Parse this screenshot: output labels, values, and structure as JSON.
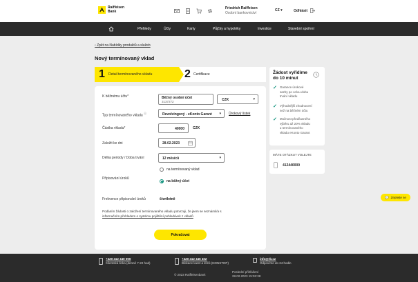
{
  "brand": {
    "name_line1": "Raiffeisen",
    "name_line2": "Bank"
  },
  "header": {
    "user_name": "Friedrich Raiffeisen",
    "user_role": "Osobní bankovnictví",
    "language": "CZ",
    "logout_label": "Odhlásit"
  },
  "nav": {
    "items": [
      "Přehledy",
      "Účty",
      "Karty",
      "Půjčky a hypotéky",
      "Investice",
      "Stavební spoření"
    ]
  },
  "back_link": "Zpět na Nabídky produktů a služeb",
  "page_title": "Nový termínovaný vklad",
  "stepper": {
    "step1_num": "1",
    "step1_label": "Detail termínovaného vkladu",
    "step2_num": "2",
    "step2_label": "Certifikace"
  },
  "form": {
    "account_label": "K běžnému účtu*",
    "account_name": "Běžný osobní účet",
    "account_number": "3137272",
    "currency_select": "CZK",
    "type_label": "Typ termínovaného vkladu",
    "type_value": "Revolvingový - eKonto Garant",
    "type_link": "Úrokový lístek",
    "amount_label": "Částka vkladu*",
    "amount_value": "40000",
    "amount_currency": "CZK",
    "date_label": "Založit ke dni",
    "date_value": "28.02.2023",
    "period_label": "Délka periody / Doba trvání",
    "period_value": "12 měsíců",
    "interest_label": "Připisování úroků",
    "radio1": "na termínovaný vklad",
    "radio2": "na běžný účet",
    "frequency_label": "Frekvence připisování úroků",
    "frequency_value": "čtvrtletně",
    "consent_text": "Podáním žádosti o založení termínovaného vkladu potvrzuji, že jsem se seznámil/a s",
    "consent_link": "informačním přehledem o systému pojištění pohledávek z vkladů",
    "submit": "Pokračovat"
  },
  "side": {
    "title_line1": "Žádost vyřídíme",
    "title_line2": "do 10 minut",
    "points": [
      [
        "Garance úrokové",
        "sazby po celou dobu",
        "trvání vkladu"
      ],
      [
        "Výhodnější zhodnocení",
        "než na běžném účtu"
      ],
      [
        "Možnost předčasného",
        "výběru až 20% vkladu",
        "u termínovaného",
        "vkladu eKonto Garant"
      ]
    ],
    "contact_title": "MÁTE OTÁZKU? VOLEJTE",
    "contact_phone": "412440000"
  },
  "chat_label": "Zeptejte se",
  "footer": {
    "phone1": "+420 412 440 000",
    "phone1_desc": "Klientská linka (denně 7-22 hod)",
    "phone2": "+420 412 446 402",
    "phone2_desc": "Blokace karet a klíčů (NONSTOP)",
    "email": "info@rb.cz",
    "email_desc": "Odpovíme do 24 hodin",
    "copyright": "© 2023 Raiffeisenbank",
    "update_label": "Poslední přihlášení",
    "update_value": "28.02.2023 15:02:38"
  }
}
